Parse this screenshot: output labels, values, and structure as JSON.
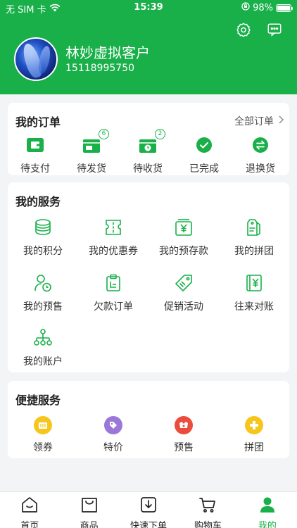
{
  "status_bar": {
    "carrier": "无 SIM 卡",
    "time": "15:39",
    "battery": "98%",
    "battery_level": 0.98
  },
  "profile": {
    "name": "林妙虚拟客户",
    "phone": "15118995750"
  },
  "orders": {
    "title": "我的订单",
    "all_link": "全部订单",
    "items": [
      {
        "label": "待支付",
        "icon": "wallet-icon",
        "badge": ""
      },
      {
        "label": "待发货",
        "icon": "box-icon",
        "badge": "6"
      },
      {
        "label": "待收货",
        "icon": "truck-icon",
        "badge": "2"
      },
      {
        "label": "已完成",
        "icon": "check-circle-icon",
        "badge": ""
      },
      {
        "label": "退换货",
        "icon": "exchange-icon",
        "badge": ""
      }
    ]
  },
  "services": {
    "title": "我的服务",
    "items": [
      {
        "label": "我的积分",
        "icon": "coins-icon"
      },
      {
        "label": "我的优惠券",
        "icon": "coupon-icon"
      },
      {
        "label": "我的预存款",
        "icon": "wallet-yen-icon"
      },
      {
        "label": "我的拼团",
        "icon": "tag-group-icon"
      },
      {
        "label": "我的预售",
        "icon": "user-clock-icon"
      },
      {
        "label": "欠款订单",
        "icon": "clipboard-icon"
      },
      {
        "label": "促销活动",
        "icon": "price-tag-icon"
      },
      {
        "label": "往来对账",
        "icon": "ledger-yen-icon"
      },
      {
        "label": "我的账户",
        "icon": "hierarchy-icon"
      }
    ]
  },
  "quick": {
    "title": "便捷服务",
    "items": [
      {
        "label": "领券",
        "icon": "voucher-icon",
        "color": "#f6c61d"
      },
      {
        "label": "特价",
        "icon": "special-price-icon",
        "color": "#9b78d8"
      },
      {
        "label": "预售",
        "icon": "presale-icon",
        "color": "#ea4d3c"
      },
      {
        "label": "拼团",
        "icon": "group-buy-icon",
        "color": "#f6c61d"
      }
    ]
  },
  "tabbar": {
    "items": [
      {
        "label": "首页",
        "icon": "home-icon"
      },
      {
        "label": "商品",
        "icon": "bag-icon"
      },
      {
        "label": "快速下单",
        "icon": "quick-order-icon"
      },
      {
        "label": "购物车",
        "icon": "cart-icon"
      },
      {
        "label": "我的",
        "icon": "person-icon",
        "active": true
      }
    ]
  },
  "colors": {
    "brand": "#19b04a",
    "background": "#f3f4f5"
  }
}
